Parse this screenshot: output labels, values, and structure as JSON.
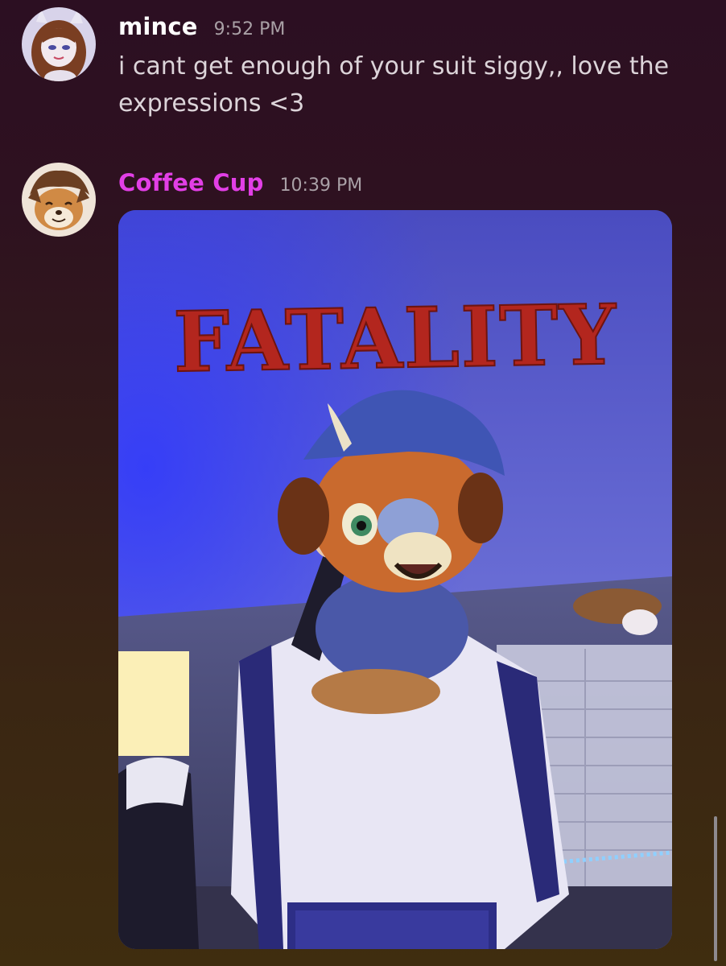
{
  "messages": [
    {
      "author": "mince",
      "timestamp": "9:52 PM",
      "text": "i cant get enough of your suit siggy,, love the expressions <3",
      "author_color": "#ffffff"
    },
    {
      "author": "Coffee Cup",
      "timestamp": "10:39 PM",
      "author_color": "#e23fe6",
      "attachment": {
        "type": "image",
        "overlay_text": "FATALITY"
      }
    }
  ],
  "colors": {
    "timestamp": "#a9a0a6",
    "message_text": "#dcd4d9",
    "fatality_red": "#b3261e"
  }
}
